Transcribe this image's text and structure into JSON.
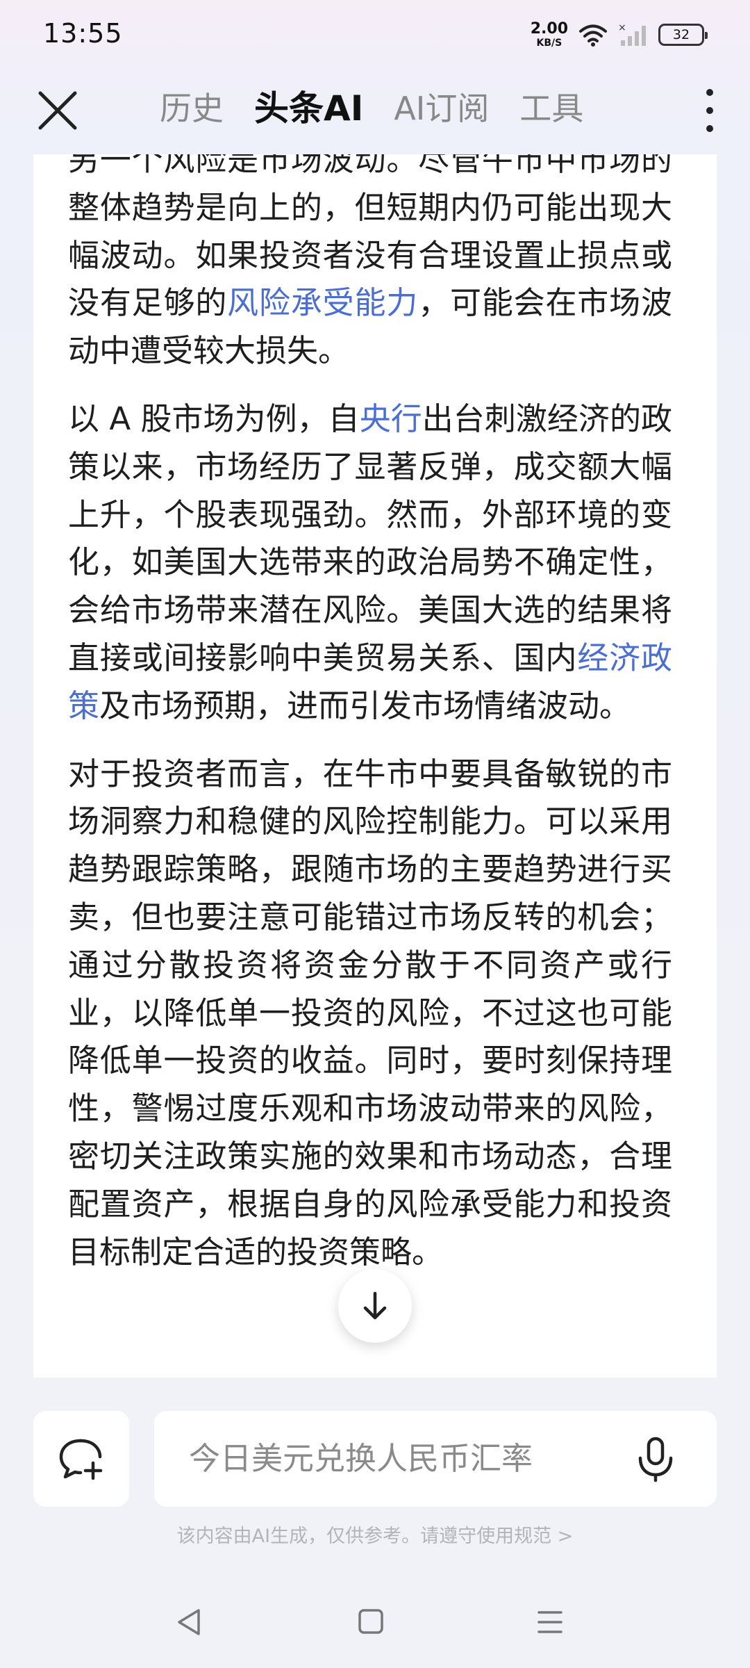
{
  "status_bar": {
    "time": "13:55",
    "net_speed_value": "2.00",
    "net_speed_unit": "KB/S",
    "battery": "32"
  },
  "header": {
    "tabs": [
      {
        "label": "历史",
        "active": false
      },
      {
        "label": "头条AI",
        "active": true
      },
      {
        "label": "AI订阅",
        "active": false
      },
      {
        "label": "工具",
        "active": false
      }
    ]
  },
  "content": {
    "p1": {
      "a": "另一个风险是市场波动。尽管牛市中市场的整体趋势是向上的，但短期内仍可能出现大幅波动。如果投资者没有合理设置止损点或没有足够的",
      "link": "风险承受能力",
      "b": "，可能会在市场波动中遭受较大损失。"
    },
    "p2": {
      "a": "以 A 股市场为例，自",
      "link1": "央行",
      "b": "出台刺激经济的政策以来，市场经历了显著反弹，成交额大幅上升，个股表现强劲。然而，外部环境的变化，如美国大选带来的政治局势不确定性，会给市场带来潜在风险。美国大选的结果将直接或间接影响中美贸易关系、国内",
      "link2": "经济政策",
      "c": "及市场预期，进而引发市场情绪波动。"
    },
    "p3": "对于投资者而言，在牛市中要具备敏锐的市场洞察力和稳健的风险控制能力。可以采用趋势跟踪策略，跟随市场的主要趋势进行买卖，但也要注意可能错过市场反转的机会；通过分散投资将资金分散于不同资产或行业，以降低单一投资的风险，不过这也可能降低单一投资的收益。同时，要时刻保持理性，警惕过度乐观和市场波动带来的风险，密切关注政策实施的效果和市场动态，合理配置资产，根据自身的风险承受能力和投资目标制定合适的投资策略。"
  },
  "input": {
    "placeholder": "今日美元兑换人民币汇率"
  },
  "disclaimer": "该内容由AI生成，仅供参考。请遵守使用规范 >",
  "icons": {
    "close": "close-icon",
    "more": "more-vertical-icon",
    "scroll_down": "arrow-down-icon",
    "new_chat": "chat-plus-icon",
    "mic": "microphone-icon",
    "nav_back": "back-triangle-icon",
    "nav_home": "home-square-icon",
    "nav_menu": "menu-lines-icon"
  },
  "colors": {
    "link": "#4a6fd1",
    "active_tab": "#111111",
    "inactive_tab": "#888888"
  }
}
